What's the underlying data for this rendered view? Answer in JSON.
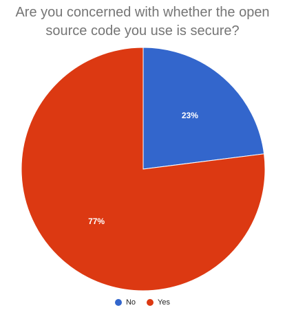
{
  "chart_data": {
    "type": "pie",
    "title": "Are you concerned with whether the open source code you use is secure?",
    "title_lines": [
      "Are you concerned with whether the open",
      "source code you use is secure?"
    ],
    "categories": [
      "No",
      "Yes"
    ],
    "values": [
      23,
      77
    ],
    "labels": [
      "23%",
      "77%"
    ],
    "colors": [
      "#3366cc",
      "#dc3912"
    ],
    "legend_position": "bottom"
  }
}
